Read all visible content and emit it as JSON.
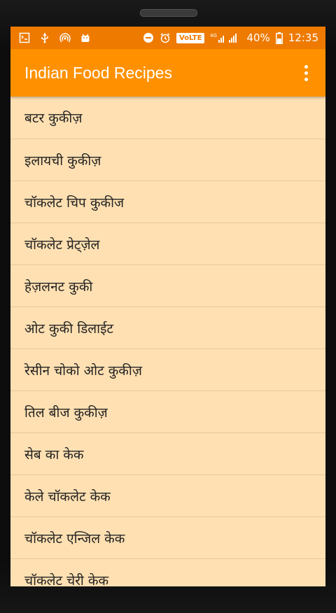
{
  "status_bar": {
    "left_icons": [
      "developer-icon",
      "usb-icon",
      "hotspot-icon",
      "android-icon"
    ],
    "volte": "VoLTE",
    "battery": "40%",
    "time": "12:35"
  },
  "app_bar": {
    "title": "Indian Food Recipes",
    "menu_icon": "more-vert-icon"
  },
  "recipes": [
    "बटर कुकीज़",
    "इलायची कुकीज़",
    "चॉकलेट चिप कुकीज",
    "चॉकलेट प्रेट्ज़ेल",
    "हेज़लनट कुकी",
    "ओट कुकी डिलाईट",
    "रेसीन चोको ओट कुकीज़",
    "तिल बीज कुकीज़",
    "सेब का केक",
    "केले चॉकलेट केक",
    "चॉकलेट एन्जिल केक",
    "चॉकलेट चेरी केक"
  ],
  "colors": {
    "status_bar": "#ee7a00",
    "app_bar": "#ff9100",
    "list_background": "#ffe0b2",
    "divider": "#e3c89c"
  }
}
